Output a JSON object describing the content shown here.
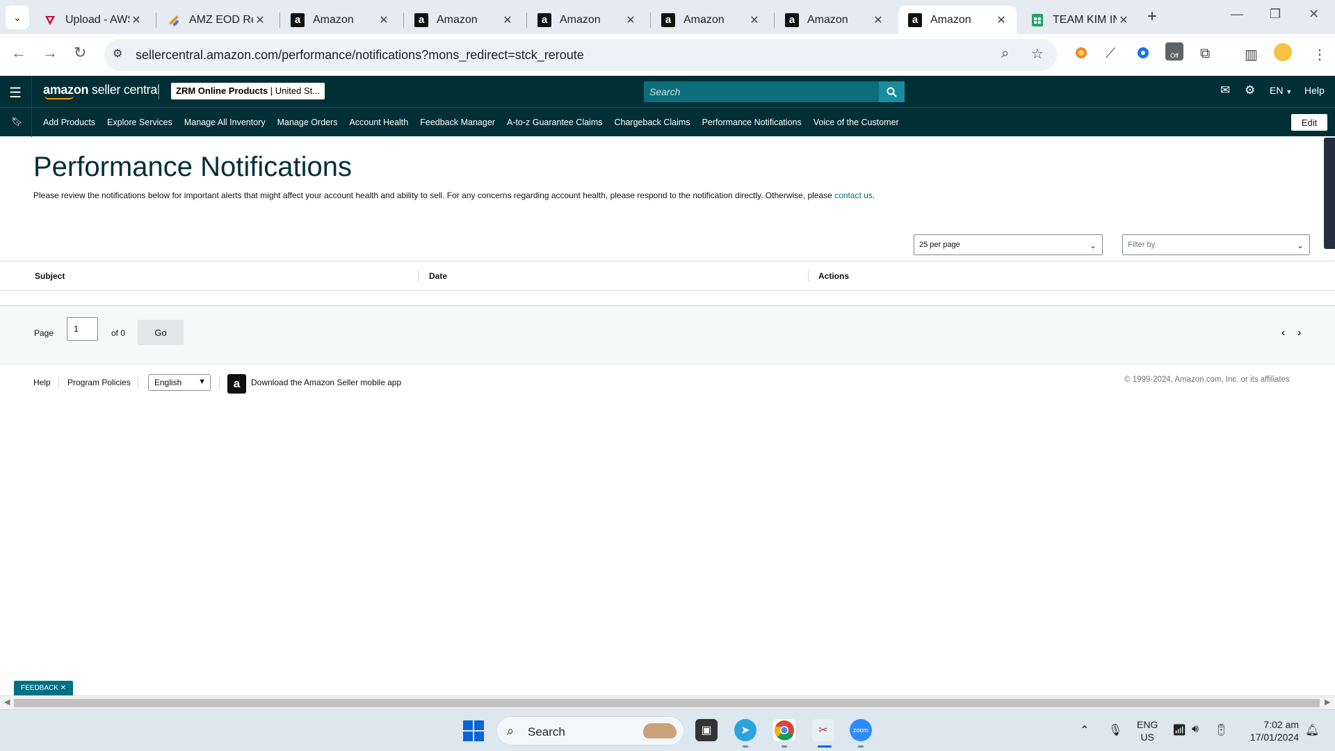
{
  "browser": {
    "tabs": [
      {
        "title": "Upload - AWS",
        "favicon": "aws-upload-icon",
        "active": false
      },
      {
        "title": "AMZ EOD Re",
        "favicon": "eod-report-icon",
        "active": false
      },
      {
        "title": "Amazon",
        "favicon": "amazon-icon",
        "active": false
      },
      {
        "title": "Amazon",
        "favicon": "amazon-icon",
        "active": false
      },
      {
        "title": "Amazon",
        "favicon": "amazon-icon",
        "active": false
      },
      {
        "title": "Amazon",
        "favicon": "amazon-icon",
        "active": false
      },
      {
        "title": "Amazon",
        "favicon": "amazon-icon",
        "active": false
      },
      {
        "title": "Amazon",
        "favicon": "amazon-icon",
        "active": true
      },
      {
        "title": "TEAM KIM IN",
        "favicon": "sheets-icon",
        "active": false
      }
    ],
    "url": "sellercentral.amazon.com/performance/notifications?mons_redirect=stck_reroute",
    "extension_badge": "Off"
  },
  "header": {
    "logo_brand": "amazon",
    "logo_product": "seller central",
    "account_name": "ZRM Online Products",
    "account_region": "United St...",
    "search_placeholder": "Search",
    "language": "EN",
    "help": "Help"
  },
  "nav": {
    "links": [
      "Add Products",
      "Explore Services",
      "Manage All Inventory",
      "Manage Orders",
      "Account Health",
      "Feedback Manager",
      "A-to-z Guarantee Claims",
      "Chargeback Claims",
      "Performance Notifications",
      "Voice of the Customer"
    ],
    "edit": "Edit"
  },
  "page": {
    "title": "Performance Notifications",
    "intro": "Please review the notifications below for important alerts that might affect your account health and ability to sell. For any concerns regarding account health, please respond to the notification directly. Otherwise, please",
    "contact_link": "contact us",
    "per_page": "25 per page",
    "filter_placeholder": "Filter by"
  },
  "table": {
    "columns": [
      "Subject",
      "Date",
      "Actions"
    ],
    "rows": []
  },
  "pager": {
    "page_label": "Page",
    "current_page": "1",
    "of_label": "of 0",
    "go": "Go"
  },
  "footer": {
    "help": "Help",
    "program_policies": "Program Policies",
    "language": "English",
    "app_download": "Download the Amazon Seller mobile app",
    "copyright": "© 1999-2024, Amazon.com, Inc. or its affiliates"
  },
  "feedback": "FEEDBACK",
  "taskbar": {
    "search": "Search",
    "lang_line1": "ENG",
    "lang_line2": "US",
    "time": "7:02 am",
    "date": "17/01/2024"
  },
  "colors": {
    "header_bg": "#002f36",
    "search_bg": "#0d6d7a",
    "link": "#007185",
    "feedback_bg": "#007185"
  }
}
